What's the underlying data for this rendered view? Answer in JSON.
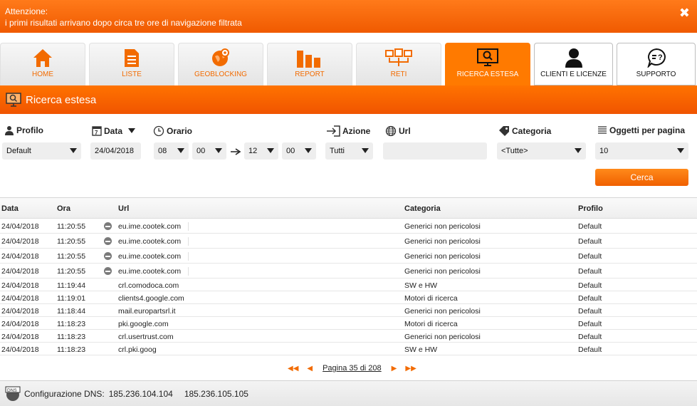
{
  "alert": {
    "line1": "Attenzione:",
    "line2": "i primi risultati arrivano dopo circa tre ore di navigazione filtrata",
    "close_icon": "✖"
  },
  "tabs": [
    {
      "label": "HOME",
      "icon": "home-icon"
    },
    {
      "label": "LISTE",
      "icon": "list-icon"
    },
    {
      "label": "GEOBLOCKING",
      "icon": "globe-pin-icon"
    },
    {
      "label": "REPORT",
      "icon": "bar-chart-icon"
    },
    {
      "label": "RETI",
      "icon": "network-icon"
    },
    {
      "label": "RICERCA ESTESA",
      "icon": "monitor-search-icon"
    },
    {
      "label": "CLIENTI E LICENZE",
      "icon": "user-icon"
    },
    {
      "label": "SUPPORTO",
      "icon": "speech-question-icon"
    }
  ],
  "section": {
    "title": "Ricerca estesa"
  },
  "filters": {
    "profilo": {
      "label": "Profilo",
      "value": "Default"
    },
    "data": {
      "label": "Data",
      "value": "24/04/2018"
    },
    "orario": {
      "label": "Orario",
      "from_h": "08",
      "from_m": "00",
      "to_h": "12",
      "to_m": "00"
    },
    "azione": {
      "label": "Azione",
      "value": "Tutti"
    },
    "url": {
      "label": "Url",
      "value": ""
    },
    "categoria": {
      "label": "Categoria",
      "value": "<Tutte>"
    },
    "oggetti": {
      "label": "Oggetti per pagina",
      "value": "10"
    },
    "search_button": "Cerca"
  },
  "table": {
    "headers": {
      "data": "Data",
      "ora": "Ora",
      "url": "Url",
      "categoria": "Categoria",
      "profilo": "Profilo"
    },
    "rows": [
      {
        "data": "24/04/2018",
        "ora": "11:20:55",
        "url": "eu.ime.cootek.com",
        "categoria": "Generici non pericolosi",
        "profilo": "Default",
        "blocked": true
      },
      {
        "data": "24/04/2018",
        "ora": "11:20:55",
        "url": "eu.ime.cootek.com",
        "categoria": "Generici non pericolosi",
        "profilo": "Default",
        "blocked": true
      },
      {
        "data": "24/04/2018",
        "ora": "11:20:55",
        "url": "eu.ime.cootek.com",
        "categoria": "Generici non pericolosi",
        "profilo": "Default",
        "blocked": true
      },
      {
        "data": "24/04/2018",
        "ora": "11:20:55",
        "url": "eu.ime.cootek.com",
        "categoria": "Generici non pericolosi",
        "profilo": "Default",
        "blocked": true
      },
      {
        "data": "24/04/2018",
        "ora": "11:19:44",
        "url": "crl.comodoca.com",
        "categoria": "SW e HW",
        "profilo": "Default",
        "blocked": false
      },
      {
        "data": "24/04/2018",
        "ora": "11:19:01",
        "url": "clients4.google.com",
        "categoria": "Motori di ricerca",
        "profilo": "Default",
        "blocked": false
      },
      {
        "data": "24/04/2018",
        "ora": "11:18:44",
        "url": "mail.europartsrl.it",
        "categoria": "Generici non pericolosi",
        "profilo": "Default",
        "blocked": false
      },
      {
        "data": "24/04/2018",
        "ora": "11:18:23",
        "url": "pki.google.com",
        "categoria": "Motori di ricerca",
        "profilo": "Default",
        "blocked": false
      },
      {
        "data": "24/04/2018",
        "ora": "11:18:23",
        "url": "crl.usertrust.com",
        "categoria": "Generici non pericolosi",
        "profilo": "Default",
        "blocked": false
      },
      {
        "data": "24/04/2018",
        "ora": "11:18:23",
        "url": "crl.pki.goog",
        "categoria": "SW e HW",
        "profilo": "Default",
        "blocked": false
      }
    ]
  },
  "pager": {
    "first": "◀◀",
    "prev": "◀",
    "text": "Pagina 35 di 208",
    "next": "▶",
    "last": "▶▶"
  },
  "footer": {
    "label": "Configurazione DNS:",
    "dns1": "185.236.104.104",
    "dns2": "185.236.105.105"
  },
  "colors": {
    "accent": "#ff7a00",
    "icon_orange": "#f26b00"
  }
}
